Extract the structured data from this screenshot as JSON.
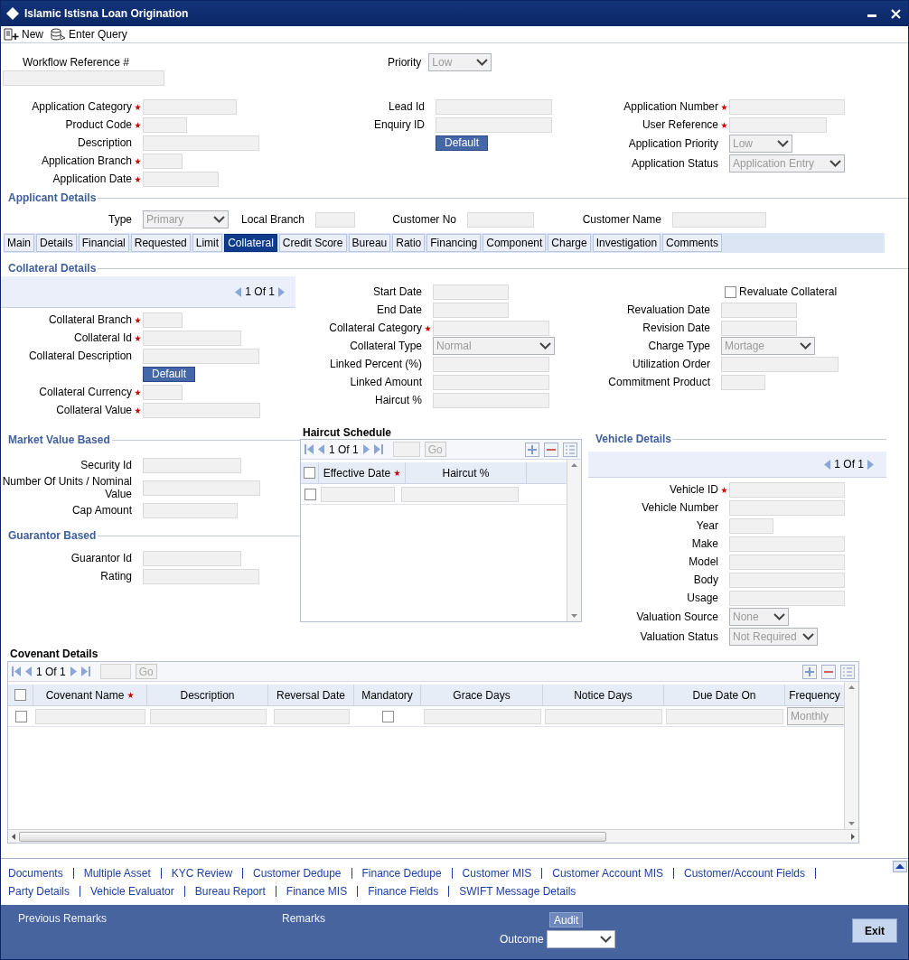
{
  "window": {
    "title": "Islamic Istisna Loan Origination"
  },
  "toolbar": [
    {
      "label": "New"
    },
    {
      "label": "Enter Query"
    }
  ],
  "workflow": {
    "label": "Workflow Reference #"
  },
  "priority": {
    "label": "Priority",
    "value": "Low"
  },
  "header": {
    "left": [
      {
        "kind": "text",
        "label": "Application Category",
        "required": true
      },
      {
        "kind": "text",
        "label": "Product Code",
        "required": true
      },
      {
        "kind": "text",
        "label": "Description",
        "required": false
      },
      {
        "kind": "text",
        "label": "Application Branch",
        "required": true
      },
      {
        "kind": "text",
        "label": "Application Date",
        "required": true
      }
    ],
    "middle": [
      {
        "kind": "text",
        "label": "Lead Id",
        "required": false
      },
      {
        "kind": "text",
        "label": "Enquiry ID",
        "required": false
      },
      {
        "kind": "button",
        "label": "Default",
        "required": false
      }
    ],
    "right": [
      {
        "kind": "text",
        "label": "Application Number",
        "required": true
      },
      {
        "kind": "text",
        "label": "User Reference",
        "required": true
      },
      {
        "kind": "select",
        "label": "Application Priority",
        "value": "Low",
        "required": false
      },
      {
        "kind": "select",
        "label": "Application Status",
        "value": "Application Entry",
        "required": false
      }
    ]
  },
  "applicant_details": {
    "title": "Applicant Details",
    "fields": [
      {
        "kind": "select",
        "label": "Type",
        "value": "Primary"
      },
      {
        "kind": "text",
        "label": "Local Branch"
      },
      {
        "kind": "text",
        "label": "Customer No"
      },
      {
        "kind": "text",
        "label": "Customer Name"
      }
    ]
  },
  "tabs": [
    {
      "label": "Main",
      "selected": false
    },
    {
      "label": "Details",
      "selected": false
    },
    {
      "label": "Financial",
      "selected": false
    },
    {
      "label": "Requested",
      "selected": false
    },
    {
      "label": "Limit",
      "selected": false
    },
    {
      "label": "Collateral",
      "selected": true
    },
    {
      "label": "Credit Score",
      "selected": false
    },
    {
      "label": "Bureau",
      "selected": false
    },
    {
      "label": "Ratio",
      "selected": false
    },
    {
      "label": "Financing",
      "selected": false
    },
    {
      "label": "Component",
      "selected": false
    },
    {
      "label": "Charge",
      "selected": false
    },
    {
      "label": "Investigation",
      "selected": false
    },
    {
      "label": "Comments",
      "selected": false
    }
  ],
  "collateral_details": {
    "title": "Collateral Details",
    "pager": "1 Of 1",
    "left": [
      {
        "kind": "text",
        "label": "Collateral Branch",
        "required": true
      },
      {
        "kind": "text",
        "label": "Collateral Id",
        "required": true
      },
      {
        "kind": "text",
        "label": "Collateral Description",
        "required": false
      },
      {
        "kind": "button",
        "label": "Default",
        "required": false
      },
      {
        "kind": "text",
        "label": "Collateral Currency",
        "required": true
      },
      {
        "kind": "text",
        "label": "Collateral Value",
        "required": true
      }
    ],
    "middle": [
      {
        "kind": "text",
        "label": "Start Date",
        "required": false
      },
      {
        "kind": "text",
        "label": "End Date",
        "required": false
      },
      {
        "kind": "text",
        "label": "Collateral Category",
        "required": true
      },
      {
        "kind": "select",
        "label": "Collateral Type",
        "value": "Normal",
        "required": false
      },
      {
        "kind": "text",
        "label": "Linked Percent (%)",
        "required": false
      },
      {
        "kind": "text",
        "label": "Linked Amount",
        "required": false
      },
      {
        "kind": "text",
        "label": "Haircut %",
        "required": false
      }
    ],
    "right": [
      {
        "kind": "checkbox",
        "label": "Revaluate Collateral",
        "checked": false,
        "required": false
      },
      {
        "kind": "text",
        "label": "Revaluation Date",
        "required": false
      },
      {
        "kind": "text",
        "label": "Revision Date",
        "required": false
      },
      {
        "kind": "select",
        "label": "Charge Type",
        "value": "Mortage",
        "required": false
      },
      {
        "kind": "text",
        "label": "Utilization Order",
        "required": false
      },
      {
        "kind": "text",
        "label": "Commitment Product",
        "required": false
      }
    ]
  },
  "market_value_based": {
    "title": "Market Value Based",
    "fields": [
      {
        "kind": "text",
        "label": "Security Id",
        "required": false
      },
      {
        "kind": "text",
        "label": "Number Of Units / Nominal Value",
        "required": false
      },
      {
        "kind": "text",
        "label": "Cap Amount",
        "required": false
      }
    ]
  },
  "guarantor_based": {
    "title": "Guarantor Based",
    "fields": [
      {
        "kind": "text",
        "label": "Guarantor Id",
        "required": false
      },
      {
        "kind": "text",
        "label": "Rating",
        "required": false
      }
    ]
  },
  "haircut_schedule": {
    "title": "Haircut Schedule",
    "pager": "1 Of 1",
    "go": "Go",
    "select_all": {
      "checked": false
    },
    "columns": [
      {
        "label": "Effective Date",
        "required": true
      },
      {
        "label": "Haircut %",
        "required": false
      }
    ],
    "rows": [
      {
        "checked": false
      }
    ]
  },
  "vehicle_details": {
    "title": "Vehicle Details",
    "pager": "1 Of 1",
    "fields": [
      {
        "kind": "text",
        "label": "Vehicle ID",
        "required": true
      },
      {
        "kind": "text",
        "label": "Vehicle Number",
        "required": false
      },
      {
        "kind": "text",
        "label": "Year",
        "required": false
      },
      {
        "kind": "text",
        "label": "Make",
        "required": false
      },
      {
        "kind": "text",
        "label": "Model",
        "required": false
      },
      {
        "kind": "text",
        "label": "Body",
        "required": false
      },
      {
        "kind": "text",
        "label": "Usage",
        "required": false
      },
      {
        "kind": "select",
        "label": "Valuation Source",
        "value": "None",
        "required": false
      },
      {
        "kind": "select",
        "label": "Valuation Status",
        "value": "Not Required",
        "required": false
      }
    ]
  },
  "covenant_details": {
    "title": "Covenant Details",
    "pager": "1 Of 1",
    "go": "Go",
    "select_all": {
      "checked": false
    },
    "columns": [
      {
        "label": "Covenant Name",
        "required": true
      },
      {
        "label": "Description",
        "required": false
      },
      {
        "label": "Reversal Date",
        "required": false
      },
      {
        "label": "Mandatory",
        "required": false
      },
      {
        "label": "Grace Days",
        "required": false
      },
      {
        "label": "Notice Days",
        "required": false
      },
      {
        "label": "Due Date On",
        "required": false
      },
      {
        "label": "Frequency",
        "required": false
      }
    ],
    "rows": [
      {
        "checked": false,
        "mandatory": false,
        "frequency": "Monthly"
      }
    ]
  },
  "links": [
    [
      "Documents",
      "Multiple Asset",
      "KYC Review",
      "Customer Dedupe",
      "Finance Dedupe",
      "Customer MIS",
      "Customer Account MIS",
      "Customer/Account Fields"
    ],
    [
      "Party Details",
      "Vehicle Evaluator",
      "Bureau Report",
      "Finance MIS",
      "Finance Fields",
      "SWIFT Message Details"
    ]
  ],
  "footer": {
    "previous_remarks": "Previous Remarks",
    "remarks": "Remarks",
    "audit": "Audit",
    "outcome": "Outcome",
    "exit": "Exit"
  }
}
